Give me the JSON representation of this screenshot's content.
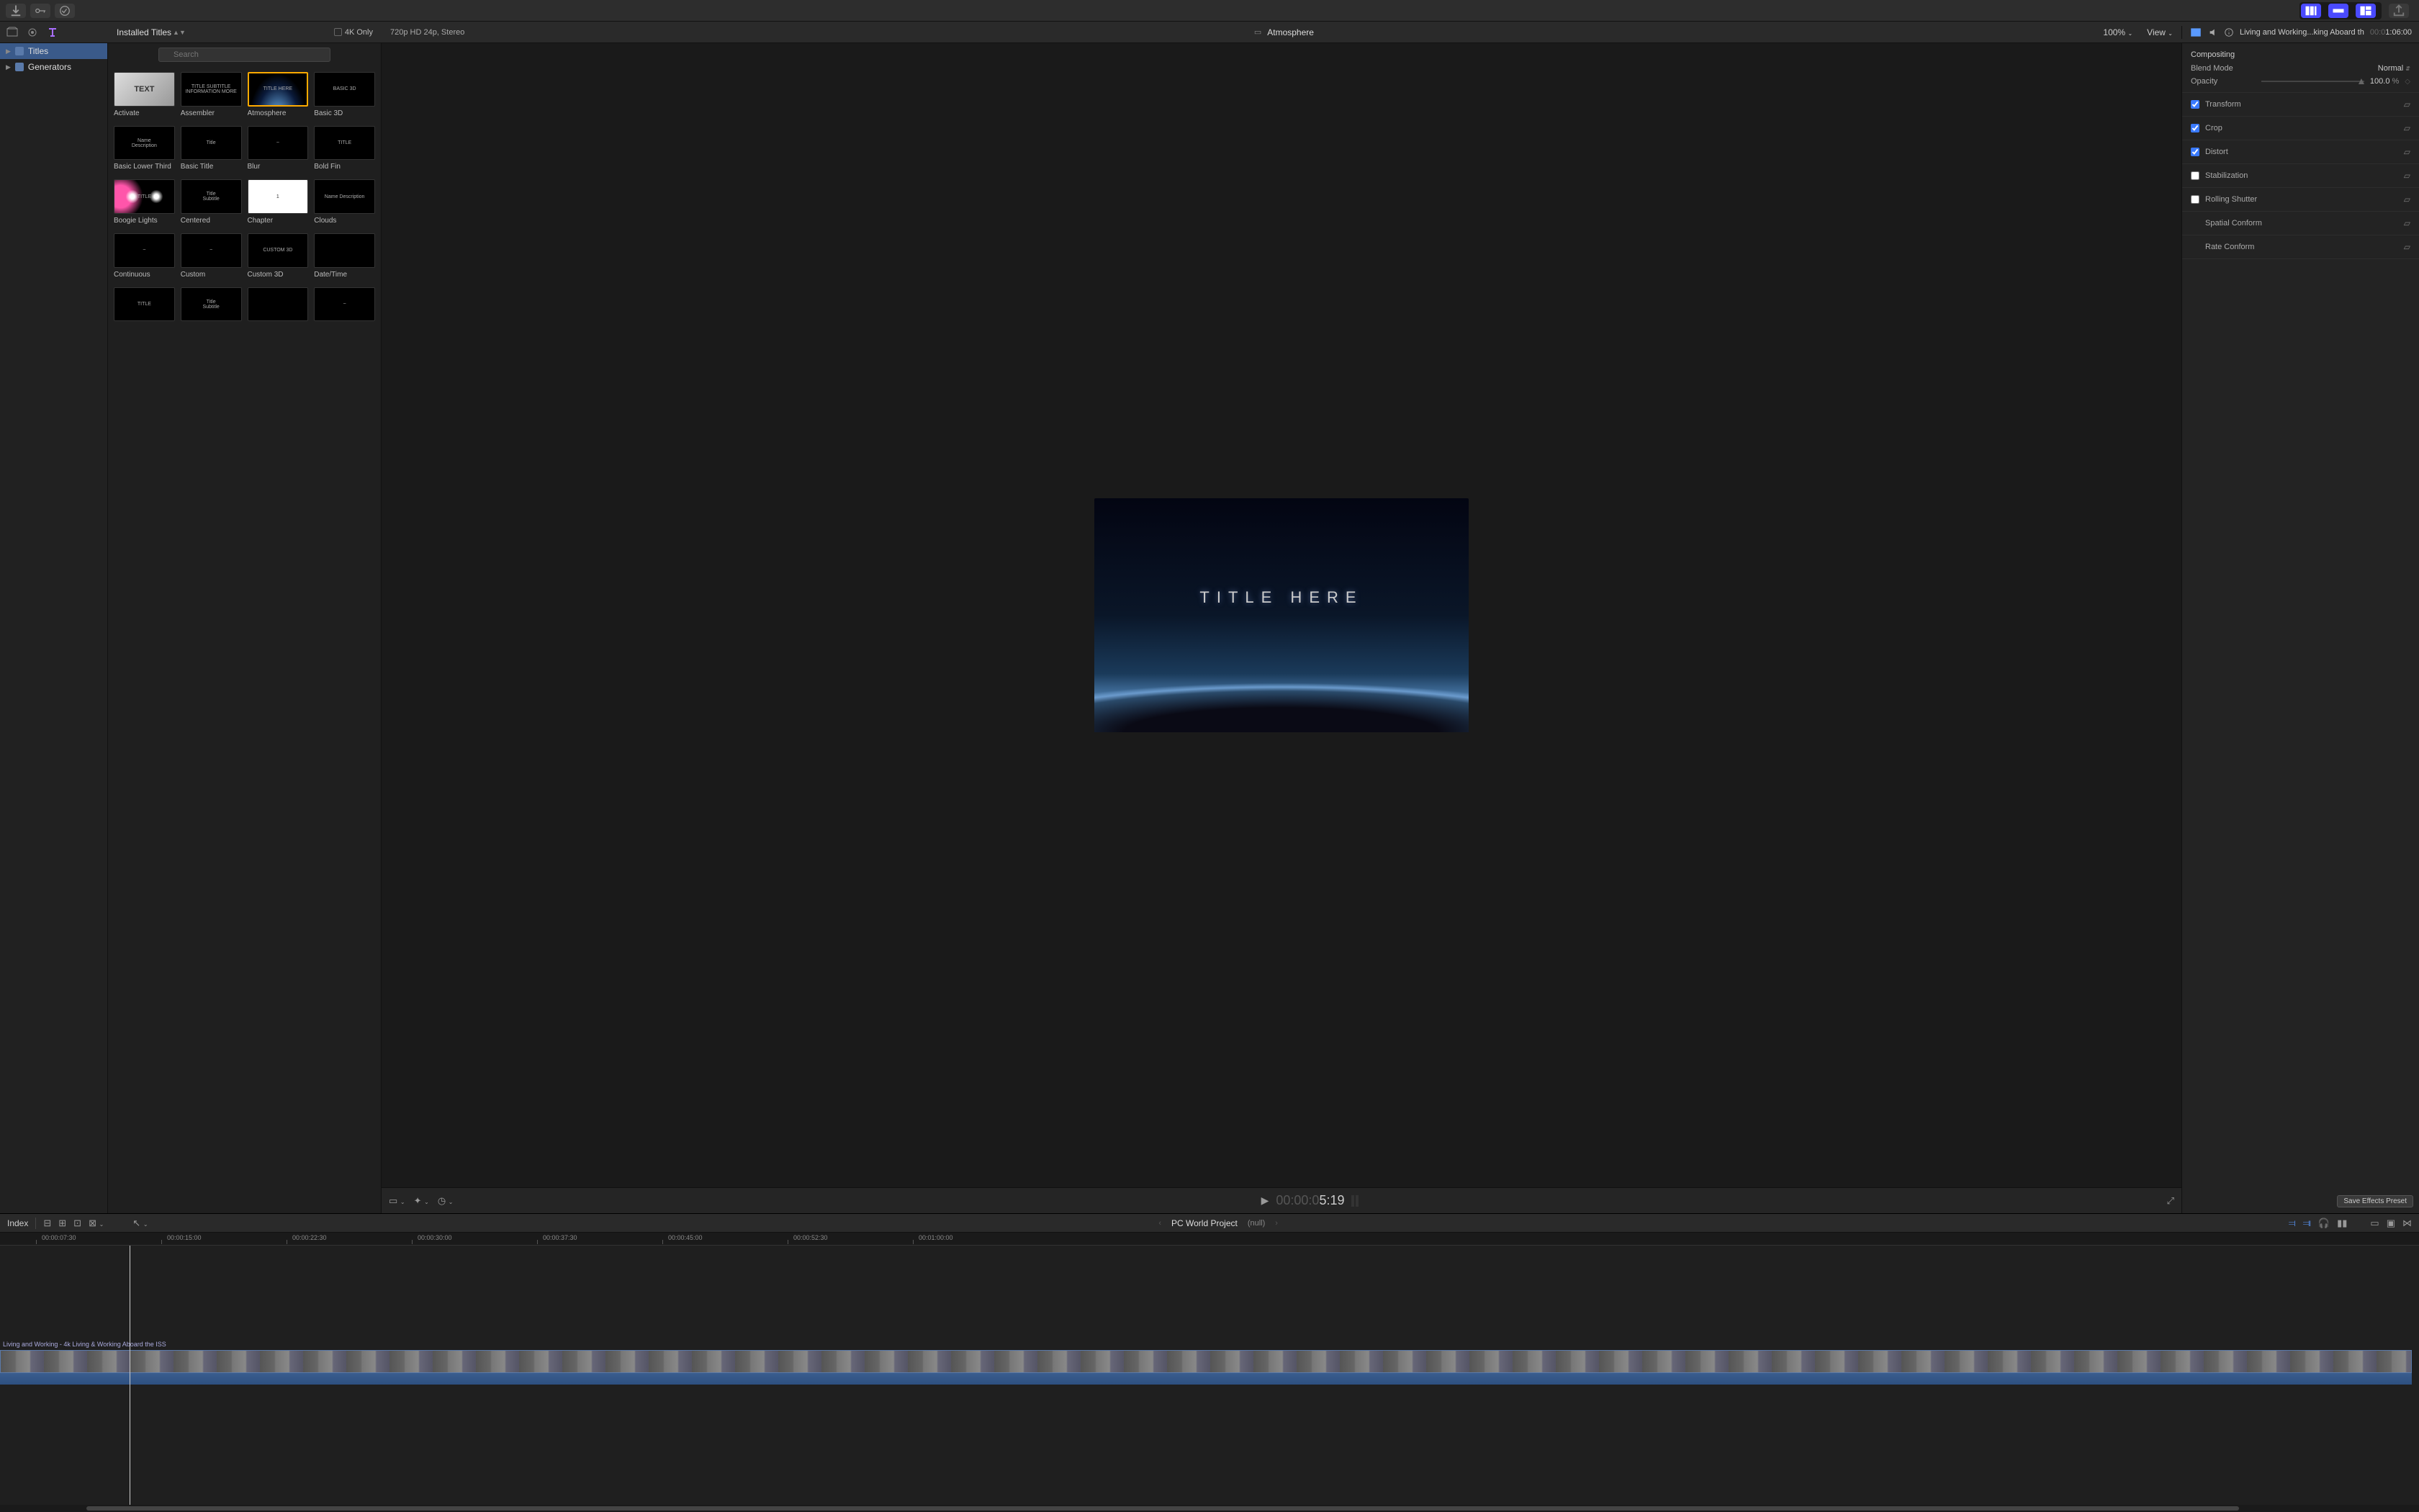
{
  "toolbar": {
    "import_icon": "import",
    "keyword_icon": "keyword",
    "bg_tasks_icon": "bg-tasks",
    "share_icon": "share"
  },
  "header": {
    "browser_title": "Installed Titles",
    "fourk_label": "4K Only",
    "format_info": "720p HD 24p, Stereo",
    "clip_name": "Atmosphere",
    "zoom": "100%",
    "view_label": "View",
    "inspector_clip": "Living and Working...king Aboard the ISS",
    "inspector_tc_dim": "00:0",
    "inspector_tc": "1:06:00"
  },
  "sidebar": {
    "items": [
      {
        "label": "Titles",
        "selected": true,
        "icon": "titles"
      },
      {
        "label": "Generators",
        "selected": false,
        "icon": "generators"
      }
    ]
  },
  "browser": {
    "search_placeholder": "Search",
    "titles": [
      {
        "label": "Activate",
        "thumb_text": "TEXT"
      },
      {
        "label": "Assembler",
        "thumb_text": "TITLE SUBTITLE\nINFORMATION MORE"
      },
      {
        "label": "Atmosphere",
        "thumb_text": "TITLE HERE",
        "selected": true
      },
      {
        "label": "Basic 3D",
        "thumb_text": "BASIC 3D"
      },
      {
        "label": "Basic Lower Third",
        "thumb_text": "Name\nDescription"
      },
      {
        "label": "Basic Title",
        "thumb_text": "Title"
      },
      {
        "label": "Blur",
        "thumb_text": "~"
      },
      {
        "label": "Bold Fin",
        "thumb_text": "TITLE"
      },
      {
        "label": "Boogie Lights",
        "thumb_text": "TITLE"
      },
      {
        "label": "Centered",
        "thumb_text": "Title\nSubtitle"
      },
      {
        "label": "Chapter",
        "thumb_text": "1"
      },
      {
        "label": "Clouds",
        "thumb_text": "Name  Description"
      },
      {
        "label": "Continuous",
        "thumb_text": "~"
      },
      {
        "label": "Custom",
        "thumb_text": "~"
      },
      {
        "label": "Custom 3D",
        "thumb_text": "CUSTOM 3D"
      },
      {
        "label": "Date/Time",
        "thumb_text": ""
      },
      {
        "label": "",
        "thumb_text": "TITLE"
      },
      {
        "label": "",
        "thumb_text": "Title\nSubtitle"
      },
      {
        "label": "",
        "thumb_text": ""
      },
      {
        "label": "",
        "thumb_text": "~"
      }
    ]
  },
  "viewer": {
    "preview_text": "TITLE HERE",
    "timecode_dim": "00:00:0",
    "timecode": "5:19"
  },
  "inspector": {
    "compositing": {
      "header": "Compositing",
      "blend_mode_label": "Blend Mode",
      "blend_mode_value": "Normal",
      "opacity_label": "Opacity",
      "opacity_value": "100.0",
      "opacity_unit": "%"
    },
    "sections": [
      {
        "label": "Transform",
        "checked": true
      },
      {
        "label": "Crop",
        "checked": true
      },
      {
        "label": "Distort",
        "checked": true
      },
      {
        "label": "Stabilization",
        "checked": false
      },
      {
        "label": "Rolling Shutter",
        "checked": false
      },
      {
        "label": "Spatial Conform",
        "nocheck": true
      },
      {
        "label": "Rate Conform",
        "nocheck": true
      }
    ],
    "save_preset": "Save Effects Preset"
  },
  "timeline": {
    "index_label": "Index",
    "project_name": "PC World Project",
    "null_label": "(null)",
    "ruler": [
      "00:00:07:30",
      "00:00:15:00",
      "00:00:22:30",
      "00:00:30:00",
      "00:00:37:30",
      "00:00:45:00",
      "00:00:52:30",
      "00:01:00:00"
    ],
    "clip_label": "Living and Working - 4k Living & Working Aboard the ISS"
  }
}
